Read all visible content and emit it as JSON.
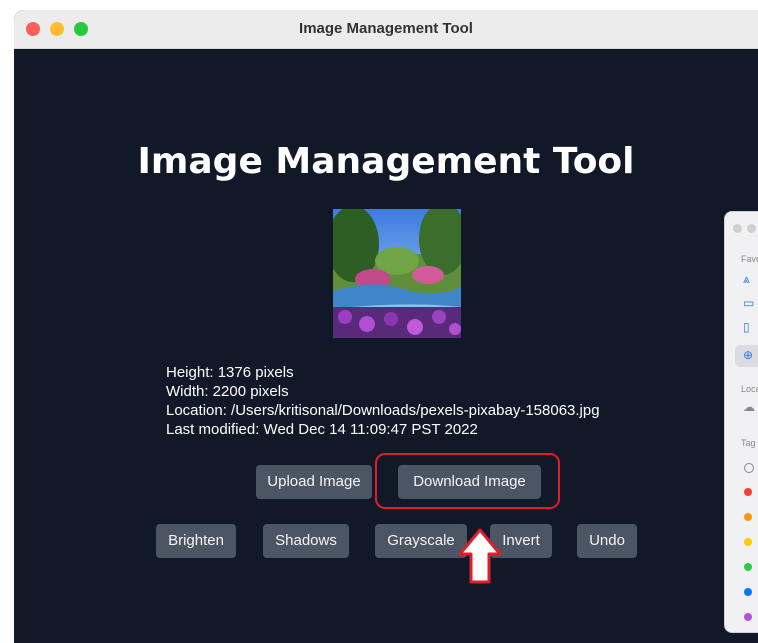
{
  "window": {
    "title": "Image Management Tool"
  },
  "main": {
    "heading": "Image Management Tool"
  },
  "image_info": {
    "height": "Height: 1376 pixels",
    "width": "Width: 2200 pixels",
    "location": "Location: /Users/kritisonal/Downloads/pexels-pixabay-158063.jpg",
    "last_modified": "Last modified: Wed Dec 14 11:09:47 PST 2022"
  },
  "buttons": {
    "upload": "Upload Image",
    "download": "Download Image",
    "brighten": "Brighten",
    "shadows": "Shadows",
    "grayscale": "Grayscale",
    "invert": "Invert",
    "undo": "Undo"
  },
  "finder": {
    "favorites_header": "Favo",
    "locations_header": "Loca",
    "tags_header": "Tag",
    "tag_colors": [
      "#ff3b30",
      "#ff9500",
      "#ffcc00",
      "#28cd41",
      "#007aff",
      "#af52de"
    ]
  },
  "colors": {
    "window_bg": "#111827",
    "button_bg": "#4b5563",
    "highlight": "#e11d2a"
  }
}
